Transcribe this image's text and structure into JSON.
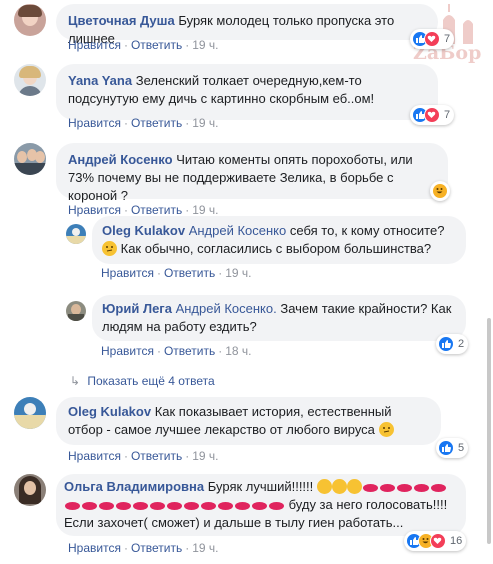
{
  "actions": {
    "like": "Нравится",
    "reply": "Ответить",
    "sep": "·"
  },
  "watermark": {
    "text": "ZaБор"
  },
  "comments": [
    {
      "author": "Цветочная Душа",
      "text": "Буряк молодец только пропуска это лишнее",
      "time": "19 ч.",
      "reactions": "7"
    },
    {
      "author": "Yana Yana",
      "text": "Зеленский толкает очередную,кем-то подсунутую ему дичь с картинно скорбным еб..ом!",
      "time": "19 ч.",
      "reactions": "7"
    },
    {
      "author": "Андрей Косенко",
      "text": "Читаю коменты опять порохоботы, или 73% почему вы не поддерживаете Зелика, в борьбе с короной ?",
      "time": "19 ч.",
      "reactions": ""
    },
    {
      "author": "Oleg Kulakov",
      "mention": "Андрей Косенко",
      "text": "себя то, к кому относите?",
      "text2": "Как обычно, согласились с выбором большинства?",
      "time": "19 ч.",
      "reactions": ""
    },
    {
      "author": "Юрий Лега",
      "mention": "Андрей Косенко.",
      "text": "Зачем такие крайности? Как людям на работу ездить?",
      "time": "18 ч.",
      "reactions": "2"
    },
    {
      "author": "Oleg Kulakov",
      "text": "Как показывает история, естественный отбор - самое лучшее лекарство от любого вируса",
      "time": "19 ч.",
      "reactions": "5"
    },
    {
      "author": "Ольга Владимировна",
      "text": "Буряк лучший!!!!!!",
      "text2": "буду за него голосовать!!!!",
      "text3": "Если захочет( сможет) и дальше в тылу гиен работать...",
      "time": "19 ч.",
      "reactions": "16"
    }
  ],
  "more_replies": "Показать ещё 4 ответа"
}
